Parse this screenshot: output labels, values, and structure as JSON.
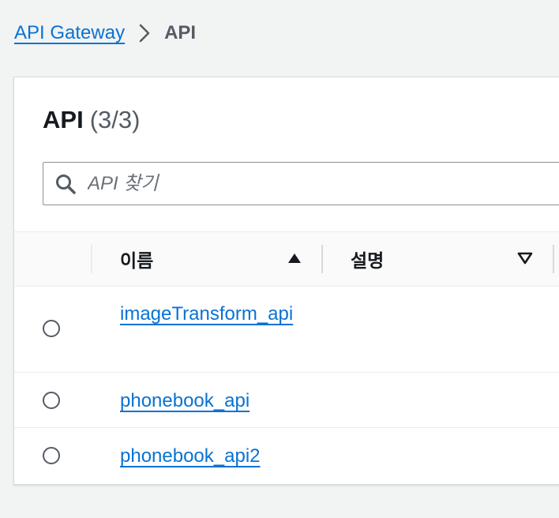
{
  "breadcrumb": {
    "parent_label": "API Gateway",
    "current_label": "API"
  },
  "panel": {
    "title": "API",
    "count": "(3/3)"
  },
  "search": {
    "placeholder": "API 찾기",
    "value": ""
  },
  "table": {
    "columns": [
      {
        "label": "이름",
        "sort": "ascending"
      },
      {
        "label": "설명",
        "sort": "descending"
      }
    ],
    "rows": [
      {
        "name": "imageTransform_api",
        "description": "",
        "selected": false
      },
      {
        "name": "phonebook_api",
        "description": "",
        "selected": false
      },
      {
        "name": "phonebook_api2",
        "description": "",
        "selected": false
      }
    ]
  },
  "colors": {
    "link": "#0972d3",
    "background": "#f2f3f3",
    "text": "#16191f"
  }
}
